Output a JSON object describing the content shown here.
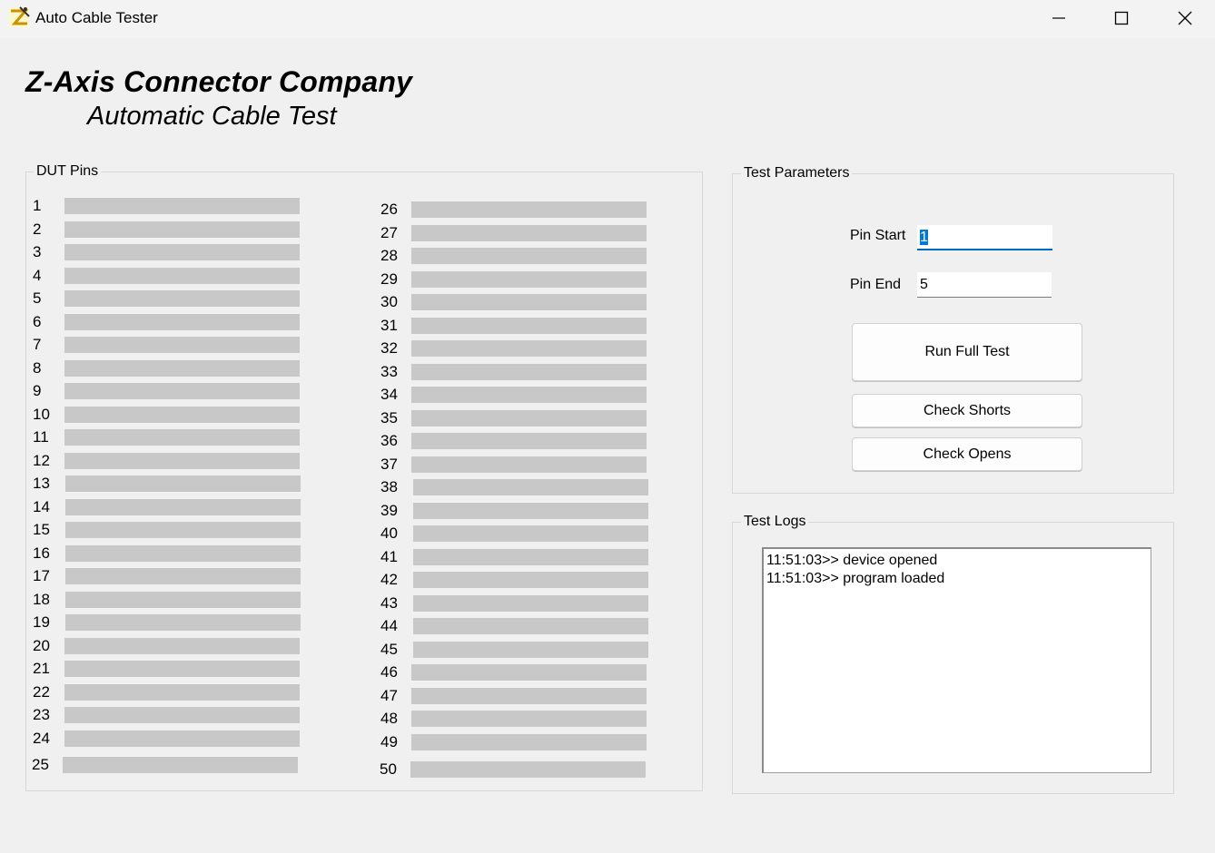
{
  "window": {
    "title": "Auto Cable Tester",
    "icon": "z-axis-logo-icon",
    "controls": [
      "minimize-icon",
      "maximize-icon",
      "close-icon"
    ]
  },
  "header": {
    "company": "Z-Axis Connector Company",
    "subtitle": "Automatic Cable Test"
  },
  "dut_pins": {
    "title": "DUT Pins",
    "pins": [
      "1",
      "2",
      "3",
      "4",
      "5",
      "6",
      "7",
      "8",
      "9",
      "10",
      "11",
      "12",
      "13",
      "14",
      "15",
      "16",
      "17",
      "18",
      "19",
      "20",
      "21",
      "22",
      "23",
      "24",
      "25",
      "26",
      "27",
      "28",
      "29",
      "30",
      "31",
      "32",
      "33",
      "34",
      "35",
      "36",
      "37",
      "38",
      "39",
      "40",
      "41",
      "42",
      "43",
      "44",
      "45",
      "46",
      "47",
      "48",
      "49",
      "50"
    ]
  },
  "test_parameters": {
    "title": "Test Parameters",
    "pin_start_label": "Pin Start",
    "pin_start_value": "1",
    "pin_end_label": "Pin End",
    "pin_end_value": "5",
    "run_full_test_label": "Run Full Test",
    "check_shorts_label": "Check Shorts",
    "check_opens_label": "Check Opens"
  },
  "test_logs": {
    "title": "Test Logs",
    "lines": [
      "11:51:03>> device opened",
      "11:51:03>> program loaded"
    ]
  },
  "colors": {
    "background": "#f0f0f0",
    "pin_bar": "#c8c8c8",
    "selection": "#0078d7",
    "focus_underline": "#0067c0"
  }
}
